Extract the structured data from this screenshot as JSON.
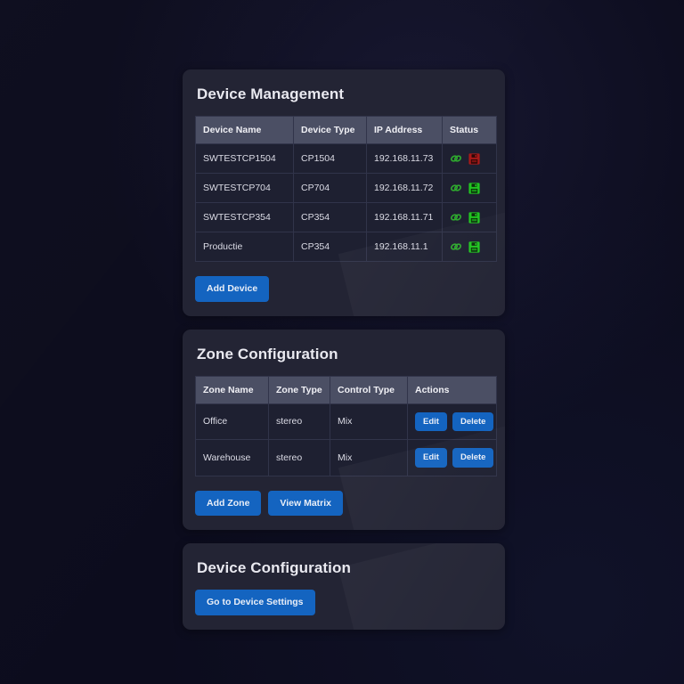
{
  "page": {
    "background_color": "#0c0c1d",
    "panel_color": "#232434",
    "accent_color": "#1464c0",
    "table_header_color": "#4b4f64",
    "table_cell_color": "#1e2031",
    "status_ok_color": "#21c521",
    "status_error_color": "#a81919",
    "link_icon_color": "#2ea82e"
  },
  "device_management": {
    "title": "Device Management",
    "columns": [
      "Device Name",
      "Device Type",
      "IP Address",
      "Status"
    ],
    "rows": [
      {
        "name": "SWTESTCP1504",
        "type": "CP1504",
        "ip": "192.168.11.73",
        "link_icon": "link-icon",
        "save_icon": "save-icon",
        "save_state": "error"
      },
      {
        "name": "SWTESTCP704",
        "type": "CP704",
        "ip": "192.168.11.72",
        "link_icon": "link-icon",
        "save_icon": "save-icon",
        "save_state": "ok"
      },
      {
        "name": "SWTESTCP354",
        "type": "CP354",
        "ip": "192.168.11.71",
        "link_icon": "link-icon",
        "save_icon": "save-icon",
        "save_state": "ok"
      },
      {
        "name": "Productie",
        "type": "CP354",
        "ip": "192.168.11.1",
        "link_icon": "link-icon",
        "save_icon": "save-icon",
        "save_state": "ok"
      }
    ],
    "add_button": "Add Device"
  },
  "zone_configuration": {
    "title": "Zone Configuration",
    "columns": [
      "Zone Name",
      "Zone Type",
      "Control Type",
      "Actions"
    ],
    "rows": [
      {
        "name": "Office",
        "type": "stereo",
        "control": "Mix",
        "edit_label": "Edit",
        "delete_label": "Delete"
      },
      {
        "name": "Warehouse",
        "type": "stereo",
        "control": "Mix",
        "edit_label": "Edit",
        "delete_label": "Delete"
      }
    ],
    "add_button": "Add Zone",
    "matrix_button": "View Matrix"
  },
  "device_configuration": {
    "title": "Device Configuration",
    "settings_button": "Go to Device Settings"
  }
}
